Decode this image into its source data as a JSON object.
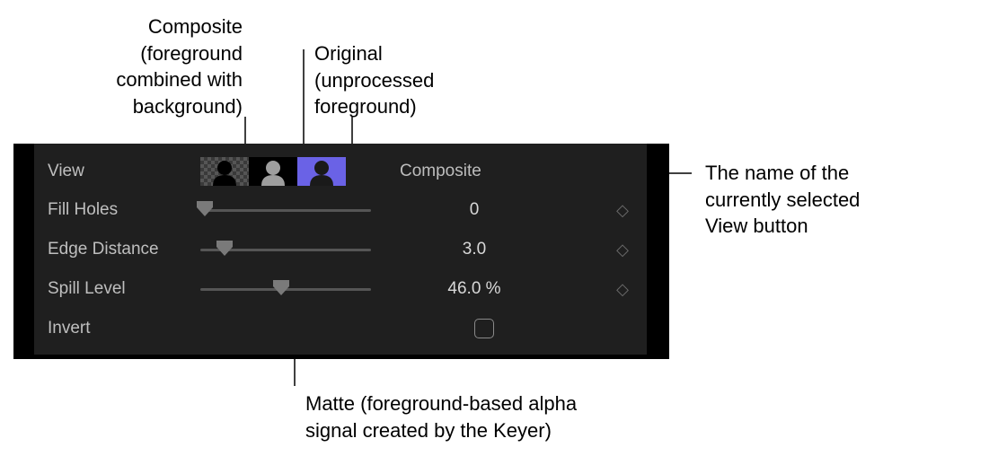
{
  "annotations": {
    "composite": "Composite\n(foreground\ncombined with\nbackground)",
    "original": "Original\n(unprocessed\nforeground)",
    "viewName": "The name of the\ncurrently selected\nView button",
    "matte": "Matte (foreground-based alpha\nsignal created by the Keyer)"
  },
  "view": {
    "label": "View",
    "selected_name": "Composite",
    "buttons": [
      "composite",
      "matte",
      "original"
    ]
  },
  "params": {
    "fill_holes": {
      "label": "Fill Holes",
      "value": "0",
      "pos": 0.0
    },
    "edge_distance": {
      "label": "Edge Distance",
      "value": "3.0",
      "pos": 0.11
    },
    "spill_level": {
      "label": "Spill Level",
      "value": "46.0 %",
      "pos": 0.46
    }
  },
  "invert": {
    "label": "Invert",
    "checked": false
  },
  "glyphs": {
    "keyframe": "◇"
  }
}
